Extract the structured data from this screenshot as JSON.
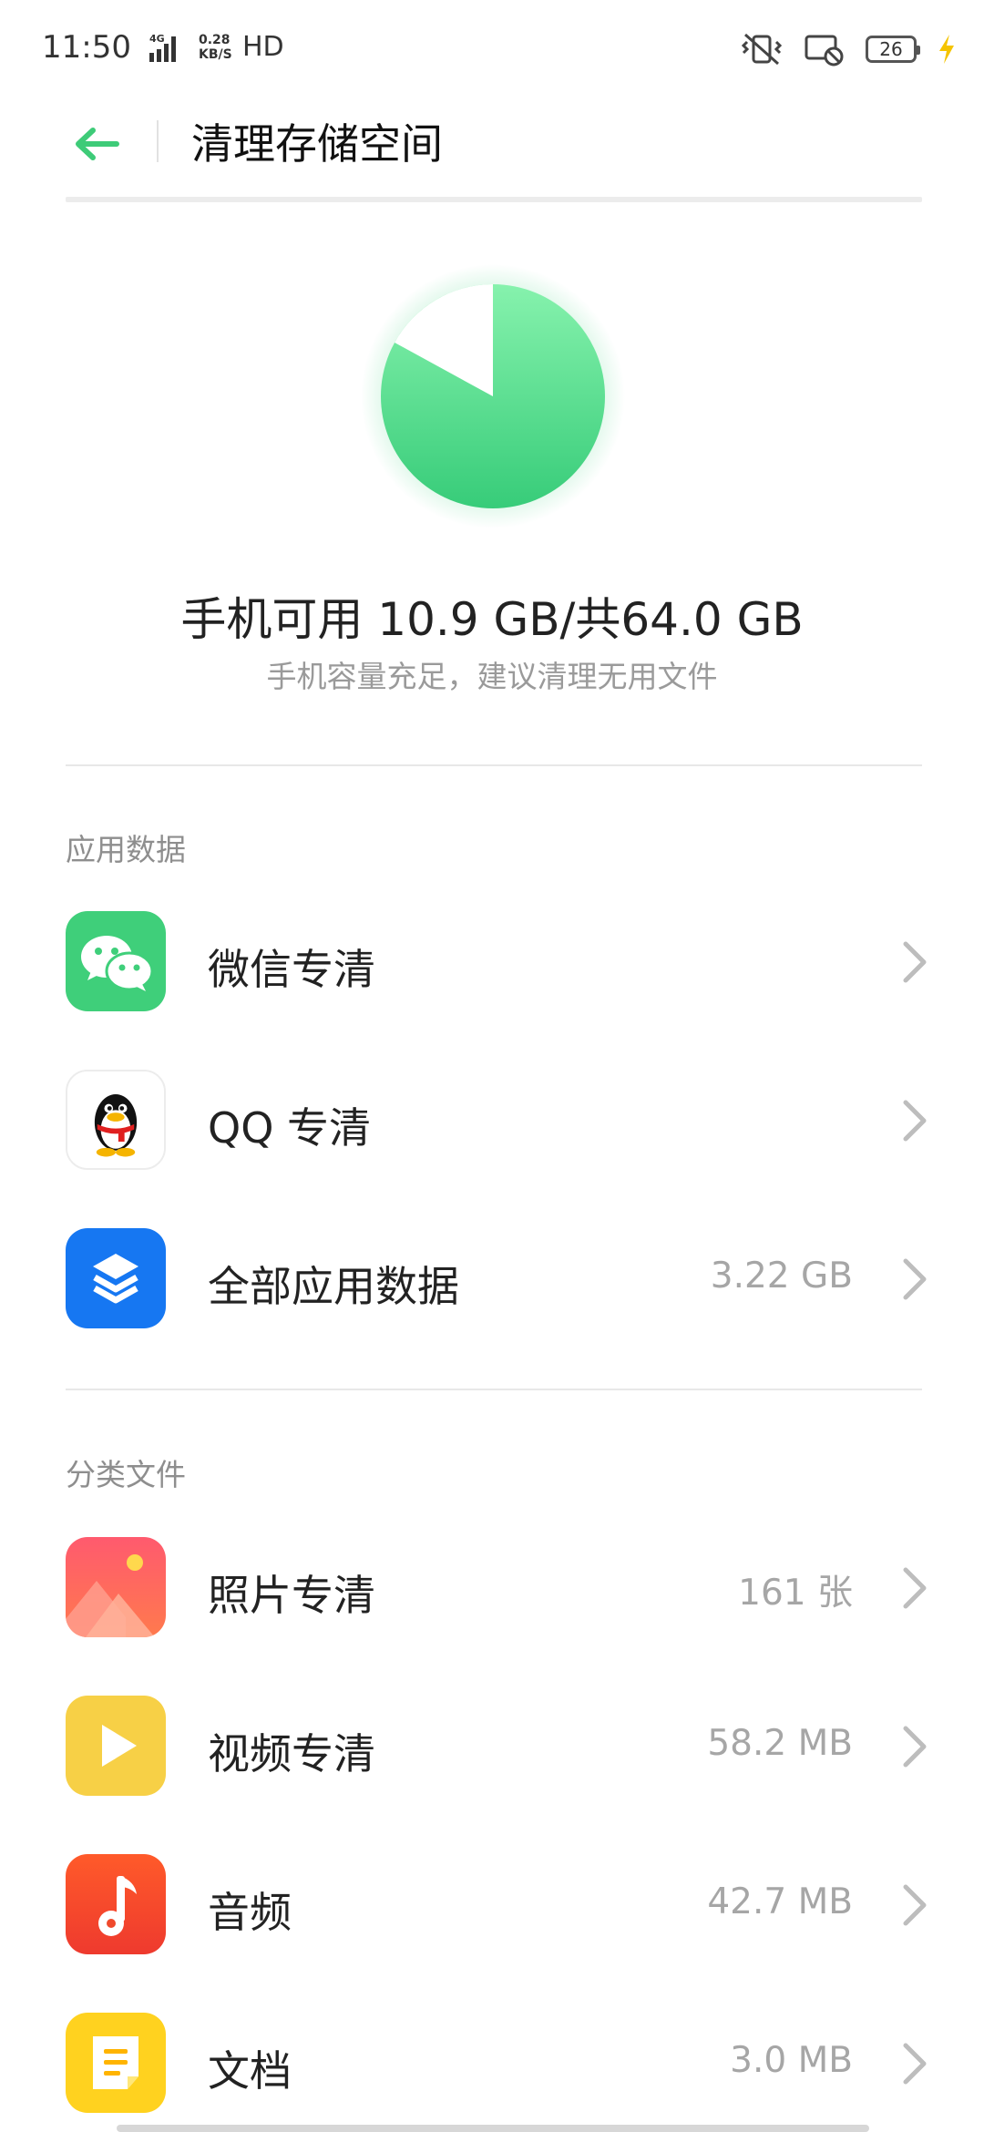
{
  "status_bar": {
    "time": "11:50",
    "network_type": "4G",
    "speed_value": "0.28",
    "speed_unit": "KB/S",
    "hd_label": "HD",
    "battery_level": "26",
    "icons": [
      "vibrate-icon",
      "no-cast-icon",
      "battery-icon",
      "charging-icon"
    ]
  },
  "header": {
    "title": "清理存储空间",
    "back_icon": "back-arrow-icon"
  },
  "storage": {
    "summary": "手机可用 10.9 GB/共64.0 GB",
    "hint": "手机容量充足，建议清理无用文件",
    "available_gb": 10.9,
    "total_gb": 64.0,
    "colors": {
      "used": "#3fd37f",
      "free": "#ffffff",
      "accent": "#3fca76"
    }
  },
  "sections": {
    "app_data": {
      "title": "应用数据",
      "items": [
        {
          "label": "微信专清",
          "value": "",
          "icon": "wechat-icon"
        },
        {
          "label": "QQ 专清",
          "value": "",
          "icon": "qq-icon"
        },
        {
          "label": "全部应用数据",
          "value": "3.22 GB",
          "icon": "app-data-icon"
        }
      ]
    },
    "categories": {
      "title": "分类文件",
      "items": [
        {
          "label": "照片专清",
          "value": "161 张",
          "icon": "photos-icon"
        },
        {
          "label": "视频专清",
          "value": "58.2 MB",
          "icon": "video-icon"
        },
        {
          "label": "音频",
          "value": "42.7 MB",
          "icon": "audio-icon"
        },
        {
          "label": "文档",
          "value": "3.0 MB",
          "icon": "document-icon"
        }
      ]
    }
  }
}
